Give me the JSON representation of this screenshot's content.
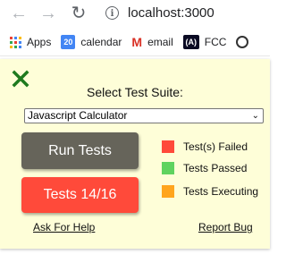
{
  "browser": {
    "url": "localhost:3000",
    "bookmarks": [
      {
        "label": "Apps",
        "icon": "apps-grid-icon"
      },
      {
        "label": "calendar",
        "icon": "calendar-icon",
        "icon_text": "20"
      },
      {
        "label": "email",
        "icon": "gmail-icon",
        "icon_text": "M"
      },
      {
        "label": "FCC",
        "icon": "fcc-icon",
        "icon_text": "(A)"
      }
    ]
  },
  "panel": {
    "suite_label": "Select Test Suite:",
    "selected_suite": "Javascript Calculator",
    "run_button": "Run Tests",
    "result_button": "Tests 14/16",
    "legend": [
      {
        "label": "Test(s) Failed",
        "color": "#ff4a3a"
      },
      {
        "label": "Tests Passed",
        "color": "#5fd35f"
      },
      {
        "label": "Tests Executing",
        "color": "#ffa51d"
      }
    ],
    "help_link": "Ask For Help",
    "bug_link": "Report Bug"
  },
  "colors": {
    "panel_bg": "#fefed8",
    "close_icon": "#1e7a1e",
    "run_button_bg": "#66645a",
    "result_button_bg": "#ff4a3a"
  }
}
